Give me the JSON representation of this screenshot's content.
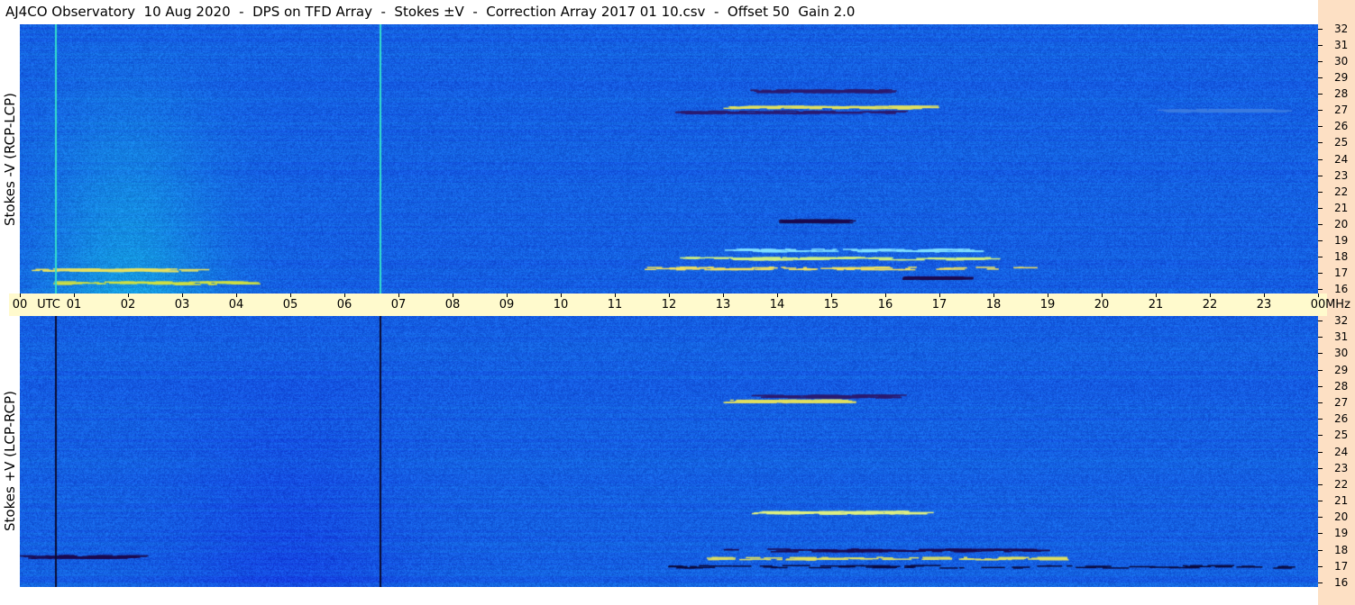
{
  "title": "AJ4CO Observatory  10 Aug 2020  -  DPS on TFD Array  -  Stokes ±V  -  Correction Array 2017 01 10.csv  -  Offset 50  Gain 2.0",
  "colors": {
    "background": "#1a5fe0",
    "right_strip": "#fde0c4",
    "axis_bar": "#fffacd"
  },
  "chart_data": [
    {
      "type": "heatmap",
      "title": "",
      "ylabel": "Stokes -V (RCP-LCP)",
      "x_ticks": [
        "00",
        "01",
        "02",
        "03",
        "04",
        "05",
        "06",
        "07",
        "08",
        "09",
        "10",
        "11",
        "12",
        "13",
        "14",
        "15",
        "16",
        "17",
        "18",
        "19",
        "20",
        "21",
        "22",
        "23",
        "00"
      ],
      "x_unit_left": "UTC",
      "x_unit_right": "MHz",
      "xlim": [
        0,
        24
      ],
      "y_ticks": [
        "32",
        "31",
        "30",
        "29",
        "28",
        "27",
        "26",
        "25",
        "24",
        "23",
        "22",
        "21",
        "20",
        "19",
        "18",
        "17",
        "16"
      ],
      "ylim": [
        16,
        32
      ],
      "vertical_lines": [
        {
          "t": 0.65,
          "color": "#33ddcc"
        },
        {
          "t": 6.65,
          "color": "#33ddcc"
        }
      ],
      "features": [
        {
          "t0": 0.0,
          "t1": 3.0,
          "f": 17.2,
          "color": "#e6e060"
        },
        {
          "t0": 0.5,
          "t1": 4.0,
          "f": 16.4,
          "color": "#d0e040"
        },
        {
          "t0": 11.5,
          "t1": 19.0,
          "f": 17.3,
          "color": "#f0e060"
        },
        {
          "t0": 12.0,
          "t1": 18.0,
          "f": 17.9,
          "color": "#d0f080"
        },
        {
          "t0": 13.0,
          "t1": 17.5,
          "f": 18.4,
          "color": "#80e0ff"
        },
        {
          "t0": 16.3,
          "t1": 17.2,
          "f": 16.7,
          "color": "#1a0a50"
        },
        {
          "t0": 14.0,
          "t1": 15.0,
          "f": 20.2,
          "color": "#1a0a50"
        },
        {
          "t0": 12.0,
          "t1": 16.0,
          "f": 26.9,
          "color": "#2a1a70"
        },
        {
          "t0": 13.0,
          "t1": 16.5,
          "f": 27.2,
          "color": "#e0e060"
        },
        {
          "t0": 13.5,
          "t1": 16.0,
          "f": 28.2,
          "color": "#2a1a70"
        },
        {
          "t0": 21.0,
          "t1": 23.0,
          "f": 27.0,
          "color": "#3a7ae0"
        }
      ]
    },
    {
      "type": "heatmap",
      "title": "",
      "ylabel": "Stokes +V (LCP-RCP)",
      "y_ticks": [
        "32",
        "31",
        "30",
        "29",
        "28",
        "27",
        "26",
        "25",
        "24",
        "23",
        "22",
        "21",
        "20",
        "19",
        "18",
        "17",
        "16"
      ],
      "ylim": [
        16,
        32
      ],
      "vertical_lines": [
        {
          "t": 0.65,
          "color": "#0a0a30"
        },
        {
          "t": 6.65,
          "color": "#0a0a30"
        }
      ],
      "features": [
        {
          "t0": 11.5,
          "t1": 23.5,
          "f": 17.0,
          "color": "#0a0a40"
        },
        {
          "t0": 12.5,
          "t1": 19.0,
          "f": 17.5,
          "color": "#e0e060"
        },
        {
          "t0": 13.0,
          "t1": 19.0,
          "f": 18.0,
          "color": "#1a0a50"
        },
        {
          "t0": 13.5,
          "t1": 16.5,
          "f": 20.3,
          "color": "#e0f080"
        },
        {
          "t0": 13.0,
          "t1": 15.0,
          "f": 27.1,
          "color": "#e0e060"
        },
        {
          "t0": 13.5,
          "t1": 16.0,
          "f": 27.4,
          "color": "#2a1a70"
        },
        {
          "t0": 0.0,
          "t1": 2.0,
          "f": 17.6,
          "color": "#1a0a50"
        }
      ]
    }
  ]
}
